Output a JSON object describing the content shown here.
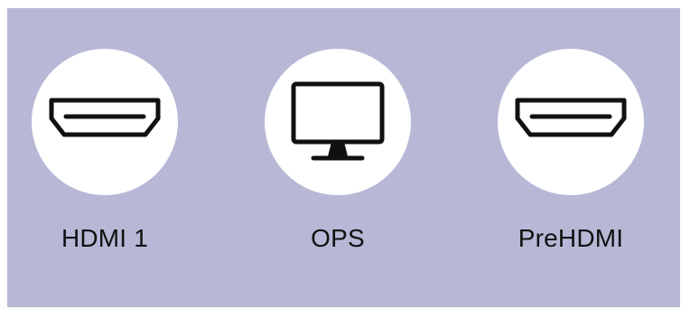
{
  "screen": {
    "background_color": "#b7b8d6",
    "sources": [
      {
        "label": "HDMI 1",
        "icon": "hdmi-icon"
      },
      {
        "label": "OPS",
        "icon": "monitor-icon"
      },
      {
        "label": "PreHDMI",
        "icon": "hdmi-icon"
      }
    ]
  }
}
